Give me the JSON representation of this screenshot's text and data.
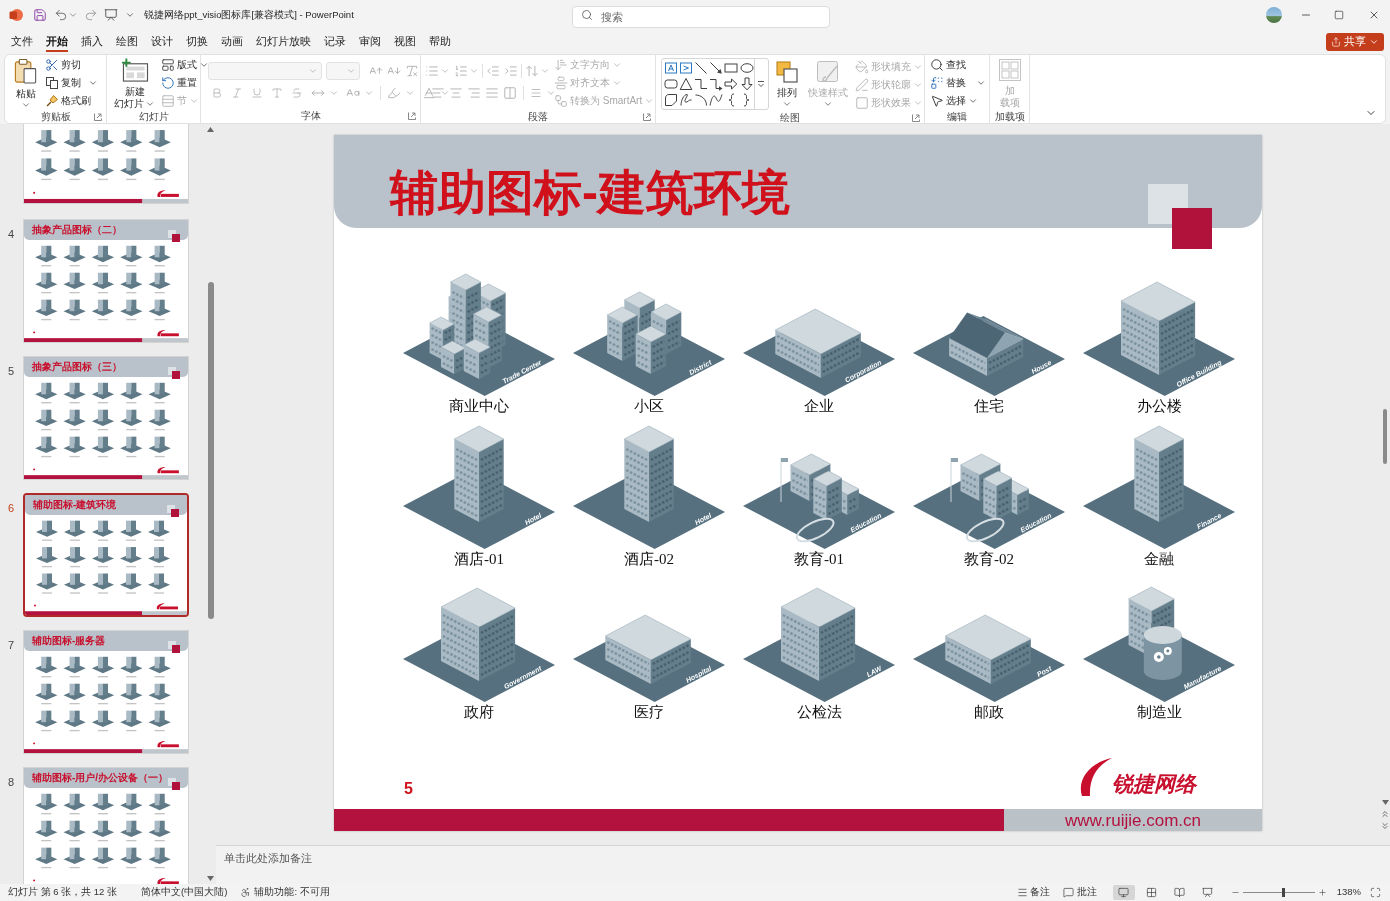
{
  "title_bar": {
    "document_title": "锐捷网络ppt_visio图标库[兼容模式] - PowerPoint",
    "search": {
      "placeholder": "搜索"
    }
  },
  "menu_tabs": [
    {
      "label": "文件",
      "selected": false
    },
    {
      "label": "开始",
      "selected": true
    },
    {
      "label": "插入",
      "selected": false
    },
    {
      "label": "绘图",
      "selected": false
    },
    {
      "label": "设计",
      "selected": false
    },
    {
      "label": "切换",
      "selected": false
    },
    {
      "label": "动画",
      "selected": false
    },
    {
      "label": "幻灯片放映",
      "selected": false
    },
    {
      "label": "记录",
      "selected": false
    },
    {
      "label": "审阅",
      "selected": false
    },
    {
      "label": "视图",
      "selected": false
    },
    {
      "label": "帮助",
      "selected": false
    }
  ],
  "share_button": {
    "label": "共享"
  },
  "ribbon": {
    "groups": [
      {
        "kind": "clipboard",
        "label": "剪贴板",
        "launcher": true,
        "items": [
          {
            "label_lines": [
              "粘贴"
            ],
            "disabled": false
          },
          {
            "label": "剪切",
            "disabled": false
          },
          {
            "label": "复制",
            "disabled": false
          },
          {
            "label": "格式刷",
            "disabled": false
          }
        ]
      },
      {
        "kind": "slides",
        "label": "幻灯片",
        "launcher": false,
        "items": [
          {
            "label_lines": [
              "新建",
              "幻灯片"
            ],
            "disabled": false
          },
          {
            "label": "版式",
            "disabled": false
          },
          {
            "label": "重置",
            "disabled": false
          },
          {
            "label": "节",
            "disabled": true
          }
        ]
      },
      {
        "kind": "font",
        "label": "字体",
        "launcher": true,
        "disabled": true
      },
      {
        "kind": "paragraph",
        "label": "段落",
        "launcher": true,
        "disabled": true,
        "items": [
          {
            "label": "文字方向",
            "disabled": true
          },
          {
            "label": "对齐文本",
            "disabled": true
          },
          {
            "label": "转换为 SmartArt",
            "disabled": true
          }
        ]
      },
      {
        "kind": "drawing",
        "label": "绘图",
        "launcher": true,
        "items": [
          {
            "label_lines": [
              "排列"
            ],
            "disabled": false
          },
          {
            "label_lines": [
              "快速样式"
            ],
            "disabled": true
          },
          {
            "label": "形状填充",
            "disabled": true
          },
          {
            "label": "形状轮廓",
            "disabled": true
          },
          {
            "label": "形状效果",
            "disabled": true
          }
        ]
      },
      {
        "kind": "editing",
        "label": "编辑",
        "launcher": false,
        "items": [
          {
            "label": "查找",
            "disabled": false
          },
          {
            "label": "替换",
            "disabled": false
          },
          {
            "label": "选择",
            "disabled": false
          }
        ]
      },
      {
        "kind": "addins",
        "label": "加载项",
        "launcher": false,
        "items": [
          {
            "label_lines": [
              "加",
              "载项"
            ],
            "disabled": true
          }
        ]
      }
    ]
  },
  "slide_panel": {
    "thumbnails": [
      {
        "selected": false
      },
      {
        "number": "4",
        "title": "抽象产品图标（二）",
        "selected": false
      },
      {
        "number": "5",
        "title": "抽象产品图标（三）",
        "selected": false
      },
      {
        "number": "6",
        "title": "辅助图标-建筑环境",
        "selected": true
      },
      {
        "number": "7",
        "title": "辅助图标-服务器",
        "selected": false
      },
      {
        "number": "8",
        "title": "辅助图标-用户/办公设备（一）",
        "selected": false
      }
    ]
  },
  "slide": {
    "title": "辅助图标-建筑环境",
    "buildings": [
      {
        "kind": "complex",
        "caption": "商业中心",
        "tag": "Trade Center"
      },
      {
        "kind": "district",
        "caption": "小区",
        "tag": "District"
      },
      {
        "kind": "low",
        "caption": "企业",
        "tag": "Corporation"
      },
      {
        "kind": "house",
        "caption": "住宅",
        "tag": "House"
      },
      {
        "kind": "office",
        "caption": "办公楼",
        "tag": "Office Building"
      },
      {
        "kind": "tower",
        "caption": "酒店-01",
        "tag": "Hotel"
      },
      {
        "kind": "tower",
        "caption": "酒店-02",
        "tag": "Hotel"
      },
      {
        "kind": "school",
        "caption": "教育-01",
        "tag": "Education"
      },
      {
        "kind": "school",
        "caption": "教育-02",
        "tag": "Education"
      },
      {
        "kind": "tower",
        "caption": "金融",
        "tag": "Finance"
      },
      {
        "kind": "office",
        "caption": "政府",
        "tag": "Government"
      },
      {
        "kind": "low",
        "caption": "医疗",
        "tag": "Hospital"
      },
      {
        "kind": "office",
        "caption": "公检法",
        "tag": "LAW"
      },
      {
        "kind": "low",
        "caption": "邮政",
        "tag": "Post"
      },
      {
        "kind": "factory",
        "caption": "制造业",
        "tag": "Manufacture"
      }
    ],
    "slide_number": "5",
    "logo_text": "锐捷网络",
    "url": "www.ruijie.com.cn"
  },
  "notes": {
    "placeholder": "单击此处添加备注"
  },
  "status_bar": {
    "slide_position": "幻灯片 第 6 张，共 12 张",
    "language": "简体中文(中国大陆)",
    "accessibility": "辅助功能: 不可用",
    "notes_button": "备注",
    "comments_button": "批注",
    "views": [
      {
        "kind": "normal",
        "selected": true
      },
      {
        "kind": "sorter",
        "selected": false
      },
      {
        "kind": "reading",
        "selected": false
      },
      {
        "kind": "slideshow",
        "selected": false
      }
    ],
    "zoom": {
      "level": 0.57,
      "reading": "138%"
    }
  }
}
